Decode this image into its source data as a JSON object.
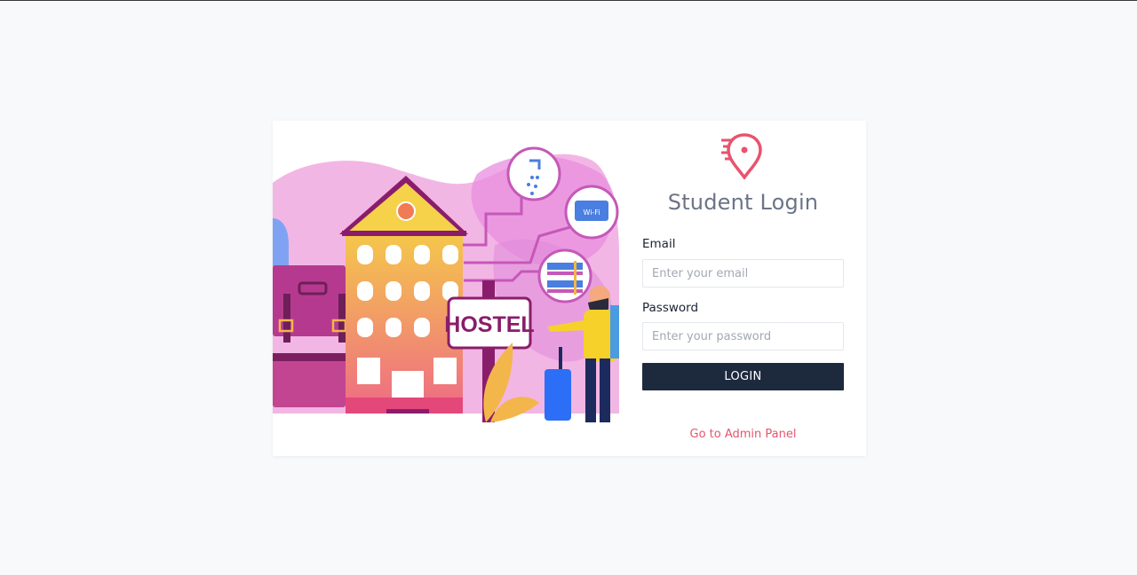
{
  "illustration": {
    "sign_text": "HOSTEL",
    "wifi_text": "Wi-Fi"
  },
  "login": {
    "title": "Student Login",
    "email_label": "Email",
    "email_placeholder": "Enter your email",
    "password_label": "Password",
    "password_placeholder": "Enter your password",
    "login_button": "LOGIN",
    "admin_link": "Go to Admin Panel"
  },
  "colors": {
    "brand": "#e8536e",
    "button": "#1d2a3e",
    "title": "#6b7487"
  },
  "icons": {
    "logo": "map-pin-speed-icon"
  }
}
